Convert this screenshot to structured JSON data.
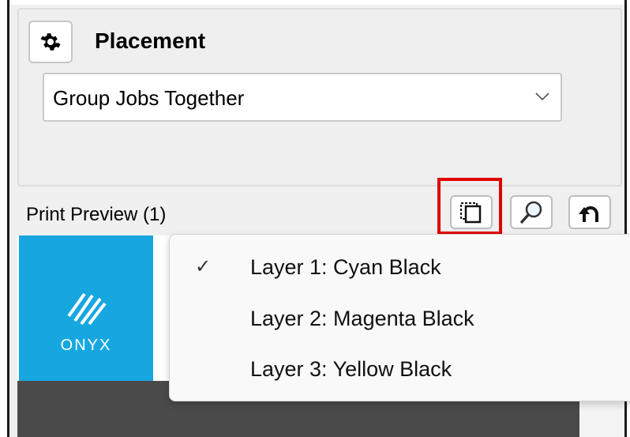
{
  "placement": {
    "title": "Placement",
    "selected": "Group Jobs Together"
  },
  "preview": {
    "label": "Print Preview (1)"
  },
  "thumbnail": {
    "brand": "ONYX",
    "color": "#16a7e0"
  },
  "toolbar": {
    "buttons": [
      {
        "icon": "layers-icon",
        "highlighted": true
      },
      {
        "icon": "magnifier-icon",
        "highlighted": false
      },
      {
        "icon": "undo-icon",
        "highlighted": false
      }
    ],
    "highlight_color": "#e10000"
  },
  "layer_menu": {
    "items": [
      {
        "label": "Layer 1: Cyan Black",
        "checked": true
      },
      {
        "label": "Layer 2: Magenta Black",
        "checked": false
      },
      {
        "label": "Layer 3: Yellow Black",
        "checked": false
      }
    ],
    "check_glyph": "✓"
  }
}
